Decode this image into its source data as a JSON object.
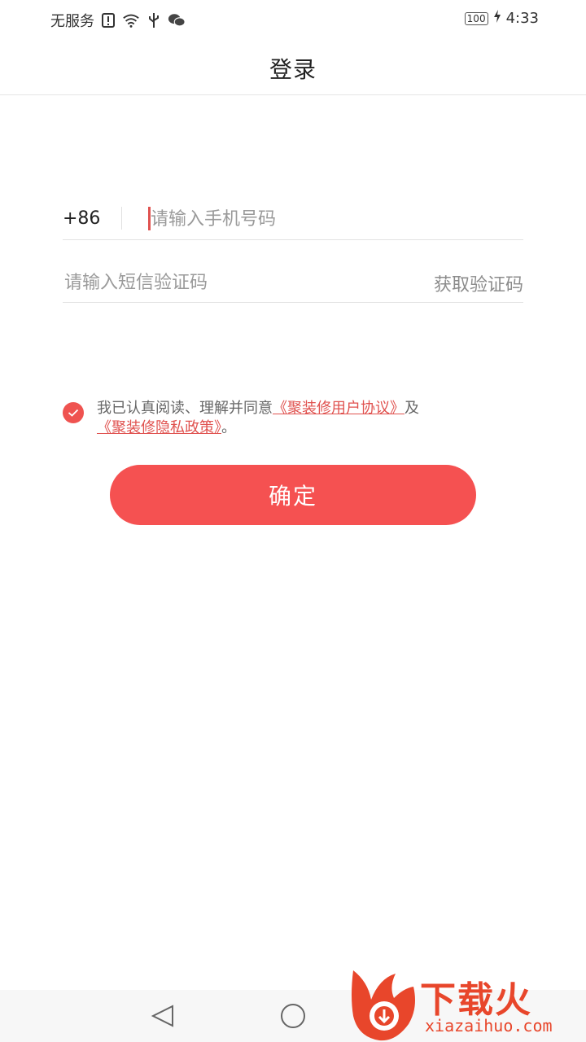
{
  "status_bar": {
    "carrier": "无服务",
    "battery": "100",
    "time": "4:33",
    "icons": [
      "alert-icon",
      "wifi-icon",
      "usb-icon",
      "wechat-icon",
      "charging-icon"
    ]
  },
  "header": {
    "title": "登录"
  },
  "phone": {
    "country_code": "+86",
    "placeholder": "请输入手机号码"
  },
  "sms": {
    "placeholder": "请输入短信验证码",
    "get_code_label": "获取验证码"
  },
  "agreement": {
    "checked": true,
    "prefix": "我已认真阅读、理解并同意",
    "user_agreement": "《聚装修用户协议》",
    "and": "及",
    "privacy_policy": "《聚装修隐私政策》",
    "suffix": "。"
  },
  "confirm_label": "确定",
  "nav": {
    "icons": [
      "back-icon",
      "home-icon"
    ]
  },
  "watermark": {
    "title": "下载火",
    "subtitle": "xiazaihuo.com"
  },
  "colors": {
    "accent": "#f55151",
    "link": "#e0524f",
    "watermark": "#e8462b"
  }
}
